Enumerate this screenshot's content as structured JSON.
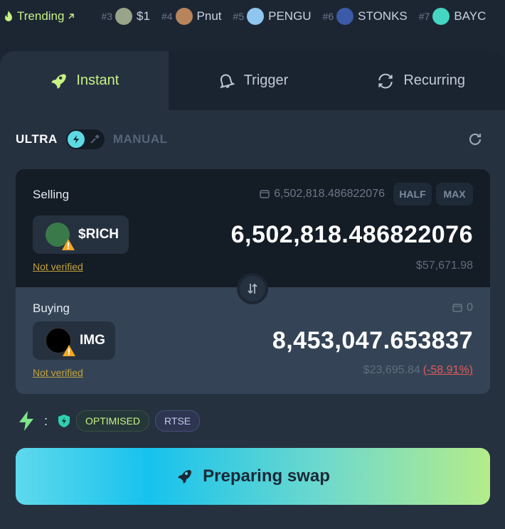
{
  "trending": {
    "label": "Trending",
    "items": [
      {
        "rank": "#3",
        "name": "$1",
        "color": "#9aa48a"
      },
      {
        "rank": "#4",
        "name": "Pnut",
        "color": "#b7845c"
      },
      {
        "rank": "#5",
        "name": "PENGU",
        "color": "#8ec6ef"
      },
      {
        "rank": "#6",
        "name": "STONKS",
        "color": "#3b5aa8"
      },
      {
        "rank": "#7",
        "name": "BAYC",
        "color": "#44d6c2"
      }
    ]
  },
  "tabs": [
    {
      "label": "Instant",
      "icon": "rocket-icon",
      "active": true
    },
    {
      "label": "Trigger",
      "icon": "bell-icon",
      "active": false
    },
    {
      "label": "Recurring",
      "icon": "recurring-icon",
      "active": false
    }
  ],
  "mode": {
    "ultra": "ULTRA",
    "manual": "MANUAL"
  },
  "selling": {
    "label": "Selling",
    "balance": "6,502,818.486822076",
    "half": "HALF",
    "max": "MAX",
    "token": "$RICH",
    "not_verified": "Not verified",
    "amount": "6,502,818.486822076",
    "usd": "$57,671.98"
  },
  "buying": {
    "label": "Buying",
    "balance": "0",
    "token": "IMG",
    "not_verified": "Not verified",
    "amount": "8,453,047.653837",
    "usd": "$23,695.84",
    "change": "(-58.91%)"
  },
  "features": {
    "separator": ":",
    "optimised": "OPTIMISED",
    "rtse": "RTSE"
  },
  "cta": {
    "label": "Preparing swap"
  },
  "colors": {
    "accent": "#c7f284",
    "warning": "#c2a23c",
    "negative": "#e25a5a"
  }
}
